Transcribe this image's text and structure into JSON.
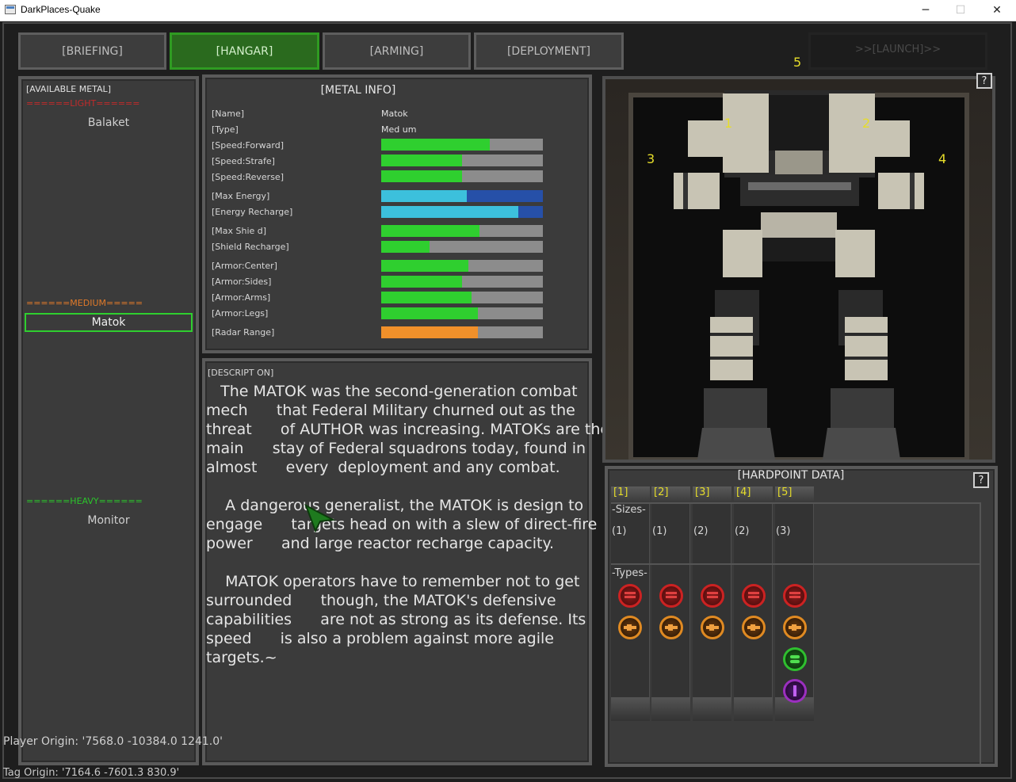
{
  "window": {
    "title": "DarkPlaces-Quake",
    "minimize": "─",
    "maximize": "☐",
    "close": "✕"
  },
  "tabs": [
    {
      "label": "[BRIEFING]"
    },
    {
      "label": "[HANGAR]"
    },
    {
      "label": "[ARMING]"
    },
    {
      "label": "[DEPLOYMENT]"
    },
    {
      "label": ">>[LAUNCH]>>"
    }
  ],
  "available": {
    "header": "[AVAILABLE METAL]",
    "light_label": "======LIGHT======",
    "medium_label": "======MEDIUM=====",
    "heavy_label": "======HEAVY======",
    "light_items": [
      "Balaket"
    ],
    "medium_items": [
      "Matok"
    ],
    "heavy_items": [
      "Monitor"
    ]
  },
  "metal_info": {
    "title": "[METAL INFO]",
    "name_label": "[Name]",
    "name_value": "Matok",
    "type_label": "[Type]",
    "type_value": "Med um",
    "stats": [
      {
        "label": "[Speed:Forward]",
        "value": 0.67,
        "color": "#2fcf2f",
        "track": "#8c8c8c"
      },
      {
        "label": "[Speed:Strafe]",
        "value": 0.5,
        "color": "#2fcf2f",
        "track": "#8c8c8c"
      },
      {
        "label": "[Speed:Reverse]",
        "value": 0.5,
        "color": "#2fcf2f",
        "track": "#8c8c8c"
      },
      {
        "label": "[Max Energy]",
        "value": 0.53,
        "color": "#3cc0dc",
        "track": "#2650a8"
      },
      {
        "label": "[Energy Recharge]",
        "value": 0.85,
        "color": "#3cc0dc",
        "track": "#2650a8"
      },
      {
        "label": "[Max Shie d]",
        "value": 0.61,
        "color": "#2fcf2f",
        "track": "#8c8c8c"
      },
      {
        "label": "[Shield Recharge]",
        "value": 0.3,
        "color": "#2fcf2f",
        "track": "#8c8c8c"
      },
      {
        "label": "[Armor:Center]",
        "value": 0.54,
        "color": "#2fcf2f",
        "track": "#8c8c8c"
      },
      {
        "label": "[Armor:Sides]",
        "value": 0.5,
        "color": "#2fcf2f",
        "track": "#8c8c8c"
      },
      {
        "label": "[Armor:Arms]",
        "value": 0.56,
        "color": "#2fcf2f",
        "track": "#8c8c8c"
      },
      {
        "label": "[Armor:Legs]",
        "value": 0.6,
        "color": "#2fcf2f",
        "track": "#8c8c8c"
      },
      {
        "label": "[Radar Range]",
        "value": 0.6,
        "color": "#f0902a",
        "track": "#8c8c8c"
      }
    ]
  },
  "description": {
    "title": "[DESCRIPT ON]",
    "text": "   The MATOK was the second-generation combat\nmech      that Federal Military churned out as the\nthreat      of AUTHOR was increasing. MATOKs are the\nmain      stay of Federal squadrons today, found in\nalmost      every  deployment and any combat.\n\n    A dangerous generalist, the MATOK is design to\nengage      targets head on with a slew of direct-fire\npower      and large reactor recharge capacity.\n\n    MATOK operators have to remember not to get\nsurrounded      though, the MATOK's defensive\ncapabilities      are not as strong as its defense. Its\nspeed      is also a problem against more agile\ntargets.~"
  },
  "viewer": {
    "help": "?",
    "hardpoint_markers": [
      "1",
      "2",
      "3",
      "4",
      "5"
    ]
  },
  "hardpoints": {
    "title": "[HARDPOINT DATA]",
    "help": "?",
    "sizes_label": "-Sizes-",
    "types_label": "-Types-",
    "slots": [
      {
        "tab": "[1]",
        "size": "(1)",
        "types": [
          "ballistic",
          "energy"
        ]
      },
      {
        "tab": "[2]",
        "size": "(1)",
        "types": [
          "ballistic",
          "energy"
        ]
      },
      {
        "tab": "[3]",
        "size": "(2)",
        "types": [
          "ballistic",
          "energy"
        ]
      },
      {
        "tab": "[4]",
        "size": "(2)",
        "types": [
          "ballistic",
          "energy"
        ]
      },
      {
        "tab": "[5]",
        "size": "(3)",
        "types": [
          "ballistic",
          "energy",
          "missile",
          "special"
        ]
      }
    ]
  },
  "debug": {
    "player_origin": "Player Origin: '7568.0 -10384.0 1241.0'",
    "tag_origin": "Tag Origin: '7164.6 -7601.3 830.9'"
  }
}
